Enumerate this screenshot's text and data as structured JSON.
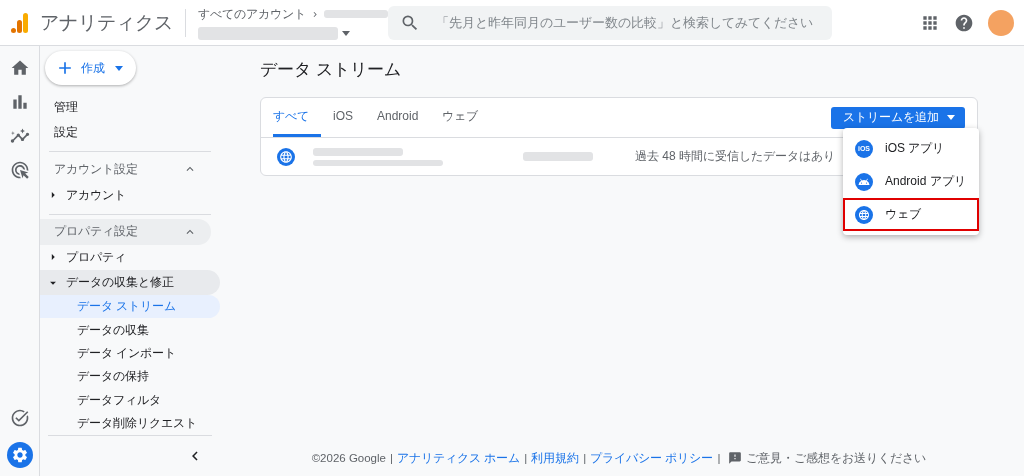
{
  "header": {
    "app_title": "アナリティクス",
    "breadcrumb": "すべてのアカウント",
    "search": {
      "placeholder": "「先月と昨年同月のユーザー数の比較」と検索してみてください"
    }
  },
  "create_button": {
    "label": "作成"
  },
  "sidebar": {
    "items": [
      {
        "kind": "link",
        "label": "管理"
      },
      {
        "kind": "link",
        "label": "設定"
      },
      {
        "kind": "section",
        "label": "アカウント設定",
        "expanded": true
      },
      {
        "kind": "group",
        "label": "アカウント",
        "expanded": false
      },
      {
        "kind": "section",
        "label": "プロパティ設定",
        "expanded": true
      },
      {
        "kind": "group",
        "label": "プロパティ",
        "expanded": false
      },
      {
        "kind": "group",
        "label": "データの収集と修正",
        "expanded": true,
        "children": [
          {
            "label": "データ ストリーム",
            "selected": true
          },
          {
            "label": "データの収集",
            "selected": false
          },
          {
            "label": "データ インポート",
            "selected": false
          },
          {
            "label": "データの保持",
            "selected": false
          },
          {
            "label": "データフィルタ",
            "selected": false
          },
          {
            "label": "データ削除リクエスト",
            "selected": false
          }
        ]
      }
    ]
  },
  "page_title": "データ ストリーム",
  "tabs": [
    {
      "label": "すべて",
      "selected": true
    },
    {
      "label": "iOS",
      "selected": false
    },
    {
      "label": "Android",
      "selected": false
    },
    {
      "label": "ウェブ",
      "selected": false
    }
  ],
  "add_stream_button": {
    "label": "ストリームを追加"
  },
  "streams": [
    {
      "kind": "web",
      "status": "過去 48 時間に受信したデータはあり"
    }
  ],
  "add_menu": [
    {
      "kind": "ios",
      "label": "iOS アプリ",
      "icon_text": "iOS",
      "highlighted": false
    },
    {
      "kind": "android",
      "label": "Android アプリ",
      "highlighted": false
    },
    {
      "kind": "web",
      "label": "ウェブ",
      "highlighted": true
    }
  ],
  "footer": [
    {
      "kind": "text",
      "label": "©2026 Google"
    },
    {
      "kind": "sep",
      "label": "|"
    },
    {
      "kind": "link",
      "label": "アナリティクス ホーム"
    },
    {
      "kind": "sep",
      "label": "|"
    },
    {
      "kind": "link",
      "label": "利用規約"
    },
    {
      "kind": "sep",
      "label": "|"
    },
    {
      "kind": "link",
      "label": "プライバシー ポリシー"
    },
    {
      "kind": "sep",
      "label": "|"
    },
    {
      "kind": "feedback",
      "label": "ご意見・ご感想をお送りください"
    }
  ]
}
